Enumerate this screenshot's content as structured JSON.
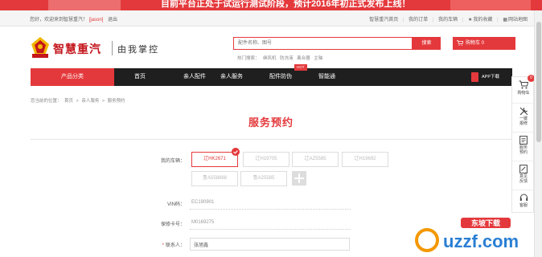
{
  "banner": {
    "text": "目前平台正处于试运行测试阶段，预计2016年初正式发布上线！"
  },
  "topbar": {
    "welcome": "您好，欢迎来到智慧重汽！",
    "username": "[jason]",
    "logout": "退出",
    "links": [
      "智慧重汽首页",
      "我的订单",
      "我的车辆",
      "我的收藏",
      "网站地图"
    ]
  },
  "header": {
    "logo_text": "智慧重汽",
    "slogan": "由我掌控",
    "search_placeholder": "配件名称、图号",
    "search_button": "搜索",
    "hot_label": "热门搜索：",
    "hot_words": [
      "继风机",
      "防冻液",
      "离合器",
      "主轴"
    ],
    "cart_label": "购物车 0"
  },
  "nav": {
    "category": "产品分类",
    "items": [
      "首页",
      "亲人配件",
      "亲人服务",
      "配件防伪",
      "智能通"
    ],
    "hot_tag": "HOT",
    "app_download": "APP下载"
  },
  "breadcrumb": [
    "您当前的位置：",
    "首页",
    ">",
    "亲人服务",
    ">",
    "服务预约"
  ],
  "page_title": "服务预约",
  "form": {
    "vehicle_label": "我的车辆：",
    "vehicles": [
      "辽HK2671",
      "辽H19705",
      "辽AZ5585",
      "辽H19692",
      "鲁A558868",
      "鲁A25585"
    ],
    "selected_vehicle": "辽HK2671",
    "vin_label": "VIN码：",
    "vin_value": "EC190901",
    "warranty_label": "保修卡号：",
    "warranty_value": "M0169275",
    "contact_label": "联系人：",
    "contact_required": "*",
    "contact_value": "张旭鑫"
  },
  "sidebar": {
    "cart_count": "0",
    "items": [
      "购物车",
      "一键报修",
      "服务预约",
      "意见反馈",
      "客服"
    ]
  },
  "watermark": {
    "brand": "东坡下载",
    "domain": "uzzf.com"
  },
  "colors": {
    "accent": "#e4393c",
    "nav_bg": "#1f1f1f"
  }
}
